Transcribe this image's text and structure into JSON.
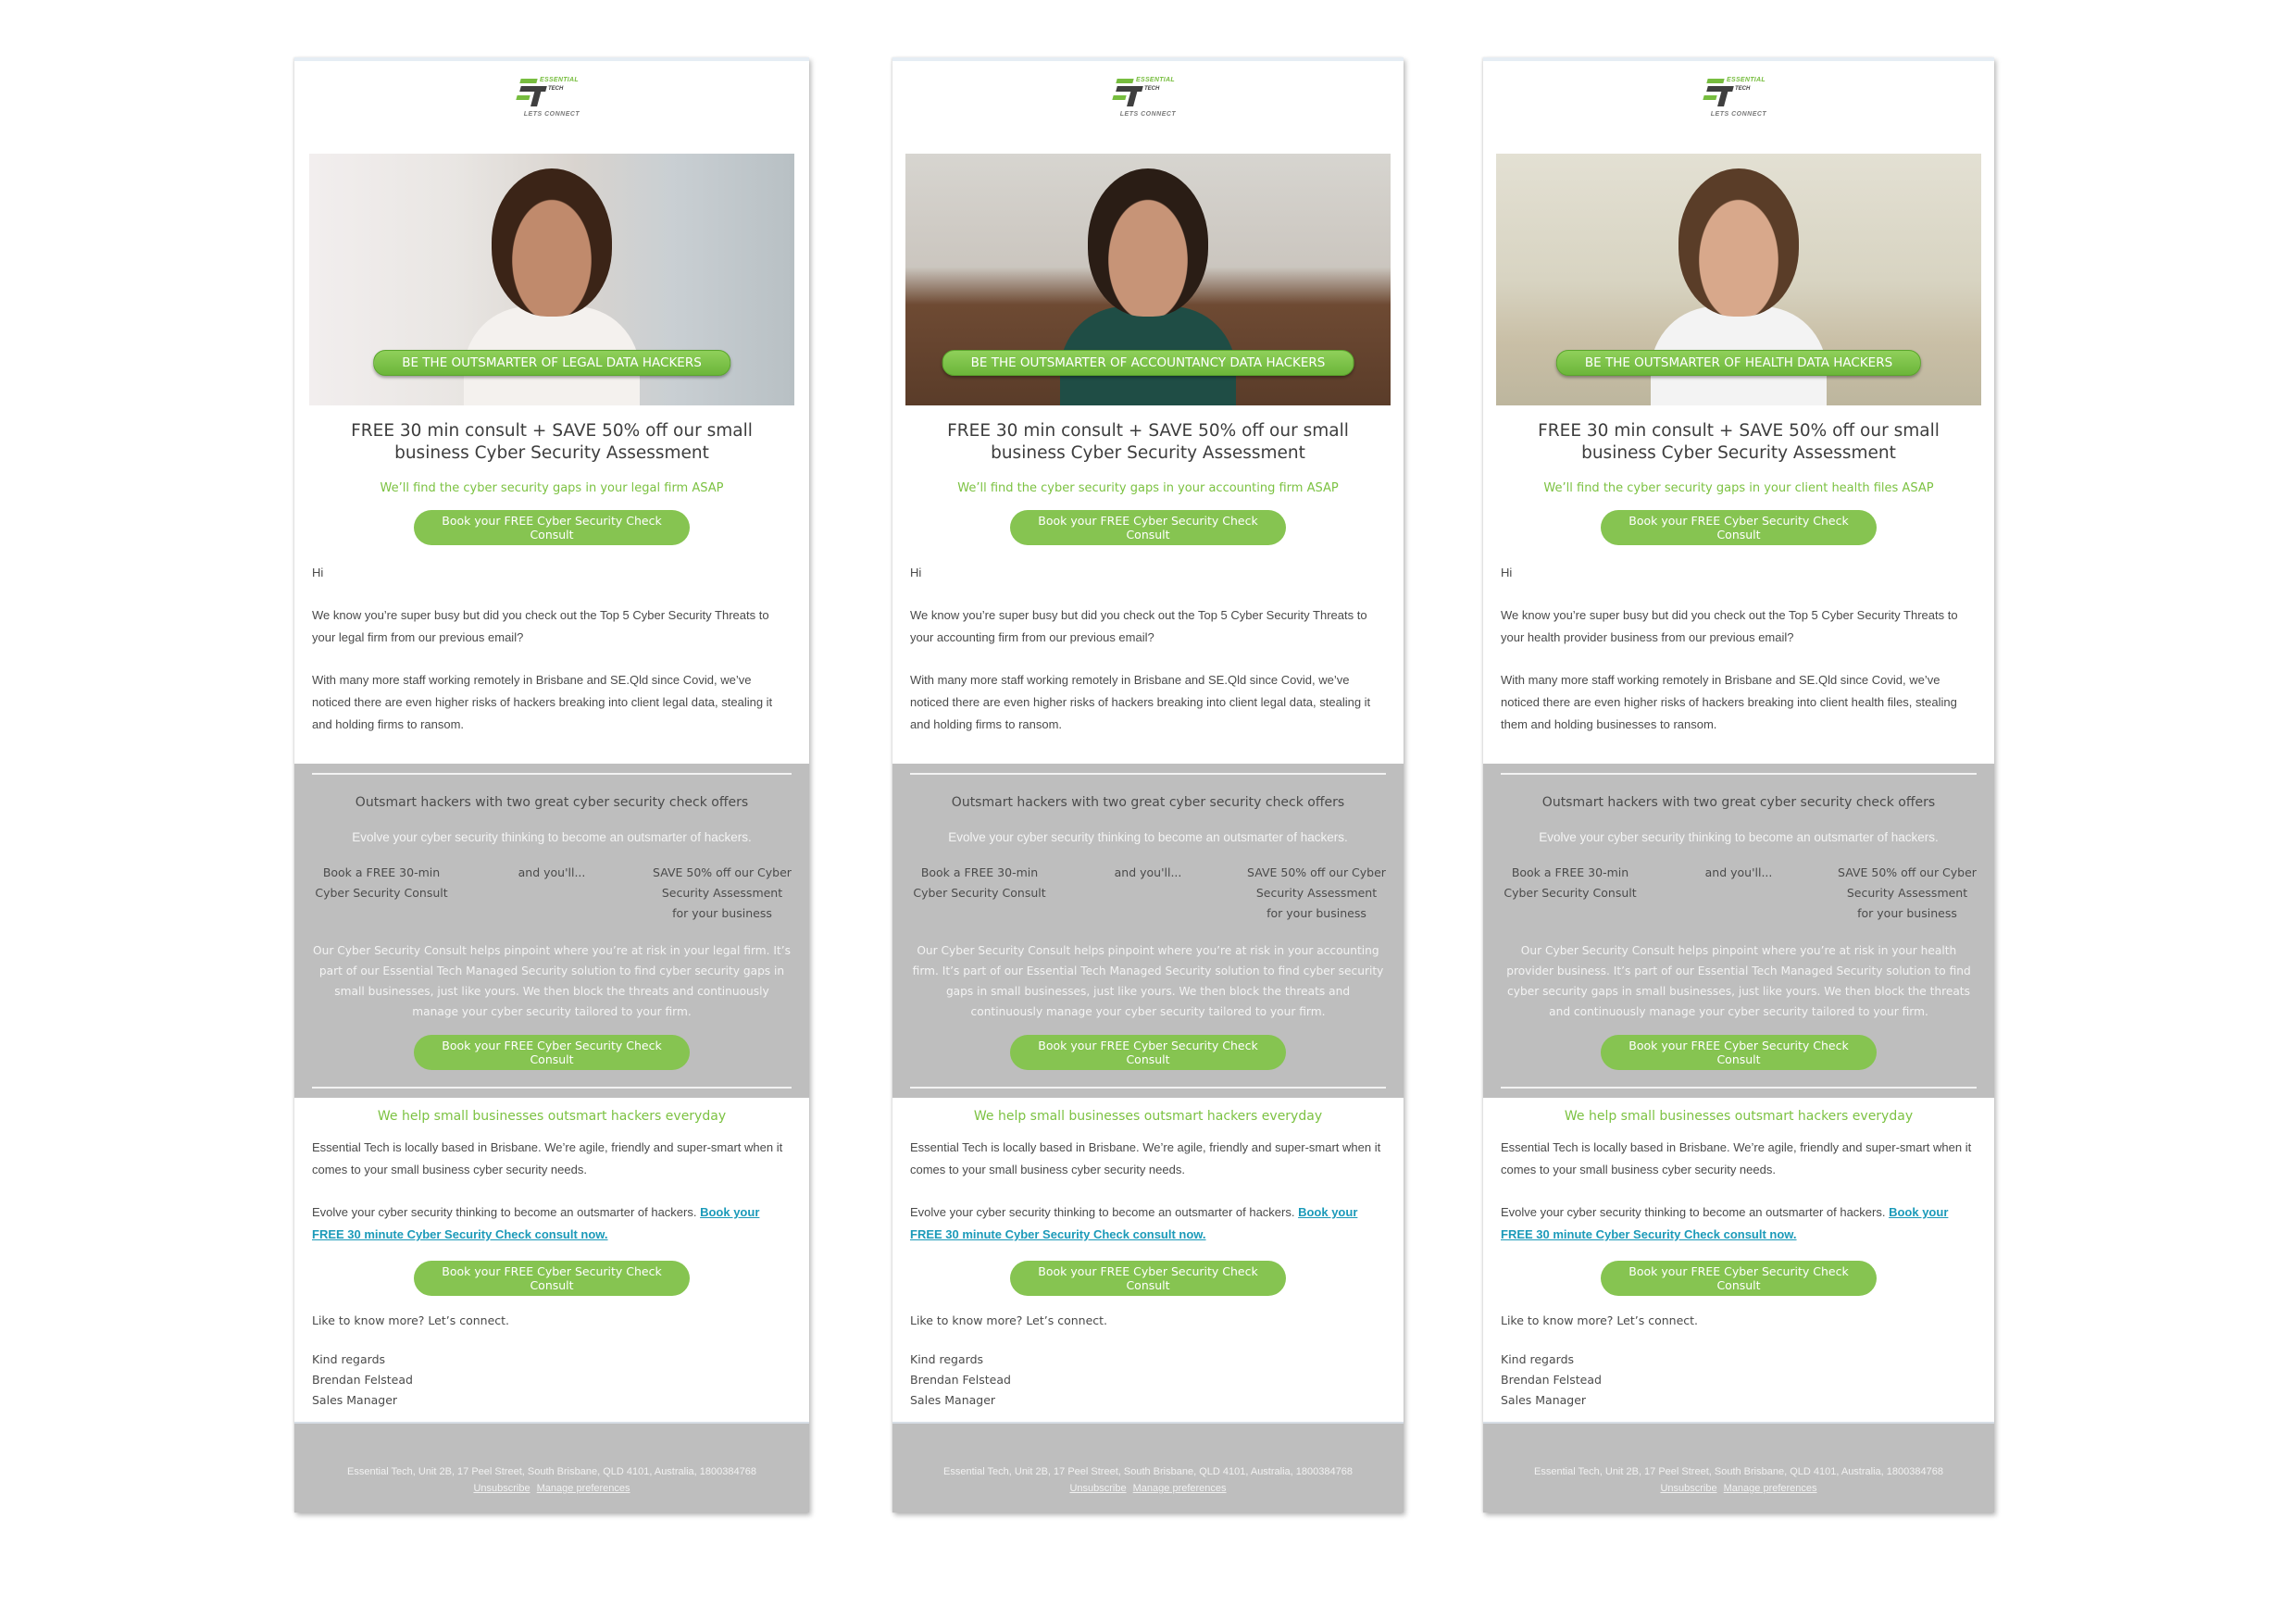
{
  "brand": {
    "logo_word1": "ESSENTIAL",
    "logo_word2": "TECH",
    "logo_tagline": "LETS CONNECT",
    "accent_color": "#86c451",
    "link_color": "#1b9ab9"
  },
  "emails": [
    {
      "hero_banner": "BE THE OUTSMARTER OF LEGAL DATA HACKERS",
      "hero_image": "woman-curly-hair-office-photo",
      "headline": "FREE 30 min consult + SAVE 50% off our small business Cyber Security Assessment",
      "subline": "We’ll find the cyber security gaps in your legal firm ASAP",
      "cta_label": "Book your FREE Cyber Security Check Consult",
      "greeting": "Hi",
      "para1": "We know you’re super busy but did you check out the Top 5 Cyber Security Threats to your legal firm from our previous email?",
      "para2": "With many more staff working remotely in Brisbane and SE.Qld since Covid, we’ve noticed there are even higher risks of hackers breaking into client legal data, stealing it and holding firms to ransom.",
      "grey_title": "Outsmart hackers with two great cyber security check offers",
      "grey_sub": "Evolve your cyber security thinking to become an outsmarter of hackers.",
      "offer1": "Book a FREE 30-min Cyber Security Consult",
      "offer_mid": "and you'll...",
      "offer2": "SAVE 50% off our Cyber Security Assessment for your business",
      "grey_para": "Our Cyber Security Consult helps pinpoint where you’re at risk in your legal firm. It’s part of our Essential Tech Managed Security solution to find cyber security gaps in small businesses, just like yours. We then block the threats and continuously manage your cyber security tailored to your firm.",
      "white_title": "We help small businesses outsmart hackers everyday",
      "para3": "Essential Tech is locally based in Brisbane. We’re agile, friendly and super-smart when it comes to your small business cyber security needs.",
      "para4": "Evolve your cyber security thinking to become an outsmarter of hackers.",
      "para4_link": "Book your FREE 30 minute Cyber Security Check consult now.",
      "connect": "Like to know more? Let’s connect.",
      "sign_off": "Kind regards",
      "sender_name": "Brendan Felstead",
      "sender_title": "Sales Manager",
      "footer_address": "Essential Tech, Unit 2B, 17 Peel Street, South Brisbane, QLD 4101, Australia, 1800384768",
      "unsubscribe": "Unsubscribe",
      "manage_prefs": "Manage preferences"
    },
    {
      "hero_banner": "BE THE OUTSMARTER OF ACCOUNTANCY DATA HACKERS",
      "hero_image": "woman-glasses-office-photo",
      "headline": "FREE 30 min consult + SAVE 50% off our small business Cyber Security Assessment",
      "subline": "We’ll find the cyber security gaps in your accounting firm ASAP",
      "cta_label": "Book your FREE Cyber Security Check Consult",
      "greeting": "Hi",
      "para1": "We know you’re super busy but did you check out the Top 5 Cyber Security Threats to your accounting firm from our previous email?",
      "para2": "With many more staff working remotely in Brisbane and SE.Qld since Covid, we’ve noticed there are even higher risks of hackers breaking into client legal data, stealing it and holding firms to ransom.",
      "grey_title": "Outsmart hackers with two great cyber security check offers",
      "grey_sub": "Evolve your cyber security thinking to become an outsmarter of hackers.",
      "offer1": "Book a FREE 30-min Cyber Security Consult",
      "offer_mid": "and you'll...",
      "offer2": "SAVE 50% off our Cyber Security Assessment for your business",
      "grey_para": "Our Cyber Security Consult helps pinpoint where you’re at risk in your accounting firm. It’s part of our Essential Tech Managed Security solution to find cyber security gaps in small businesses, just like yours. We then block the threats and continuously manage your cyber security tailored to your firm.",
      "white_title": "We help small businesses outsmart hackers everyday",
      "para3": "Essential Tech is locally based in Brisbane. We’re agile, friendly and super-smart when it comes to your small business cyber security needs.",
      "para4": "Evolve your cyber security thinking to become an outsmarter of hackers.",
      "para4_link": "Book your FREE 30 minute Cyber Security Check consult now.",
      "connect": "Like to know more? Let’s connect.",
      "sign_off": "Kind regards",
      "sender_name": "Brendan Felstead",
      "sender_title": "Sales Manager",
      "footer_address": "Essential Tech, Unit 2B, 17 Peel Street, South Brisbane, QLD 4101, Australia, 1800384768",
      "unsubscribe": "Unsubscribe",
      "manage_prefs": "Manage preferences"
    },
    {
      "hero_banner": "BE THE OUTSMARTER OF HEALTH DATA HACKERS",
      "hero_image": "doctor-woman-clinic-photo",
      "headline": "FREE 30 min consult + SAVE 50% off our small business Cyber Security Assessment",
      "subline": "We’ll find the cyber security gaps in your client health files ASAP",
      "cta_label": "Book your FREE Cyber Security Check Consult",
      "greeting": "Hi",
      "para1": "We know you’re super busy but did you check out the Top 5 Cyber Security Threats to your health provider business from our previous email?",
      "para2": "With many more staff working remotely in Brisbane and SE.Qld since Covid, we’ve noticed there are even higher risks of hackers breaking into client health files, stealing them and holding businesses to ransom.",
      "grey_title": "Outsmart hackers with two great cyber security check offers",
      "grey_sub": "Evolve your cyber security thinking to become an outsmarter of hackers.",
      "offer1": "Book a FREE 30-min Cyber Security Consult",
      "offer_mid": "and you'll...",
      "offer2": "SAVE 50% off our Cyber Security Assessment for your business",
      "grey_para": "Our Cyber Security Consult helps pinpoint where you’re at risk in your health provider business. It’s part of our Essential Tech Managed Security solution to find cyber security gaps in small businesses, just like yours. We then block the threats and continuously manage your cyber security tailored to your firm.",
      "white_title": "We help small businesses outsmart hackers everyday",
      "para3": "Essential Tech is locally based in Brisbane. We’re agile, friendly and super-smart when it comes to your small business cyber security needs.",
      "para4": "Evolve your cyber security thinking to become an outsmarter of hackers.",
      "para4_link": "Book your FREE 30 minute Cyber Security Check consult now.",
      "connect": "Like to know more? Let’s connect.",
      "sign_off": "Kind regards",
      "sender_name": "Brendan Felstead",
      "sender_title": "Sales Manager",
      "footer_address": "Essential Tech, Unit 2B, 17 Peel Street, South Brisbane, QLD 4101, Australia, 1800384768",
      "unsubscribe": "Unsubscribe",
      "manage_prefs": "Manage preferences"
    }
  ]
}
